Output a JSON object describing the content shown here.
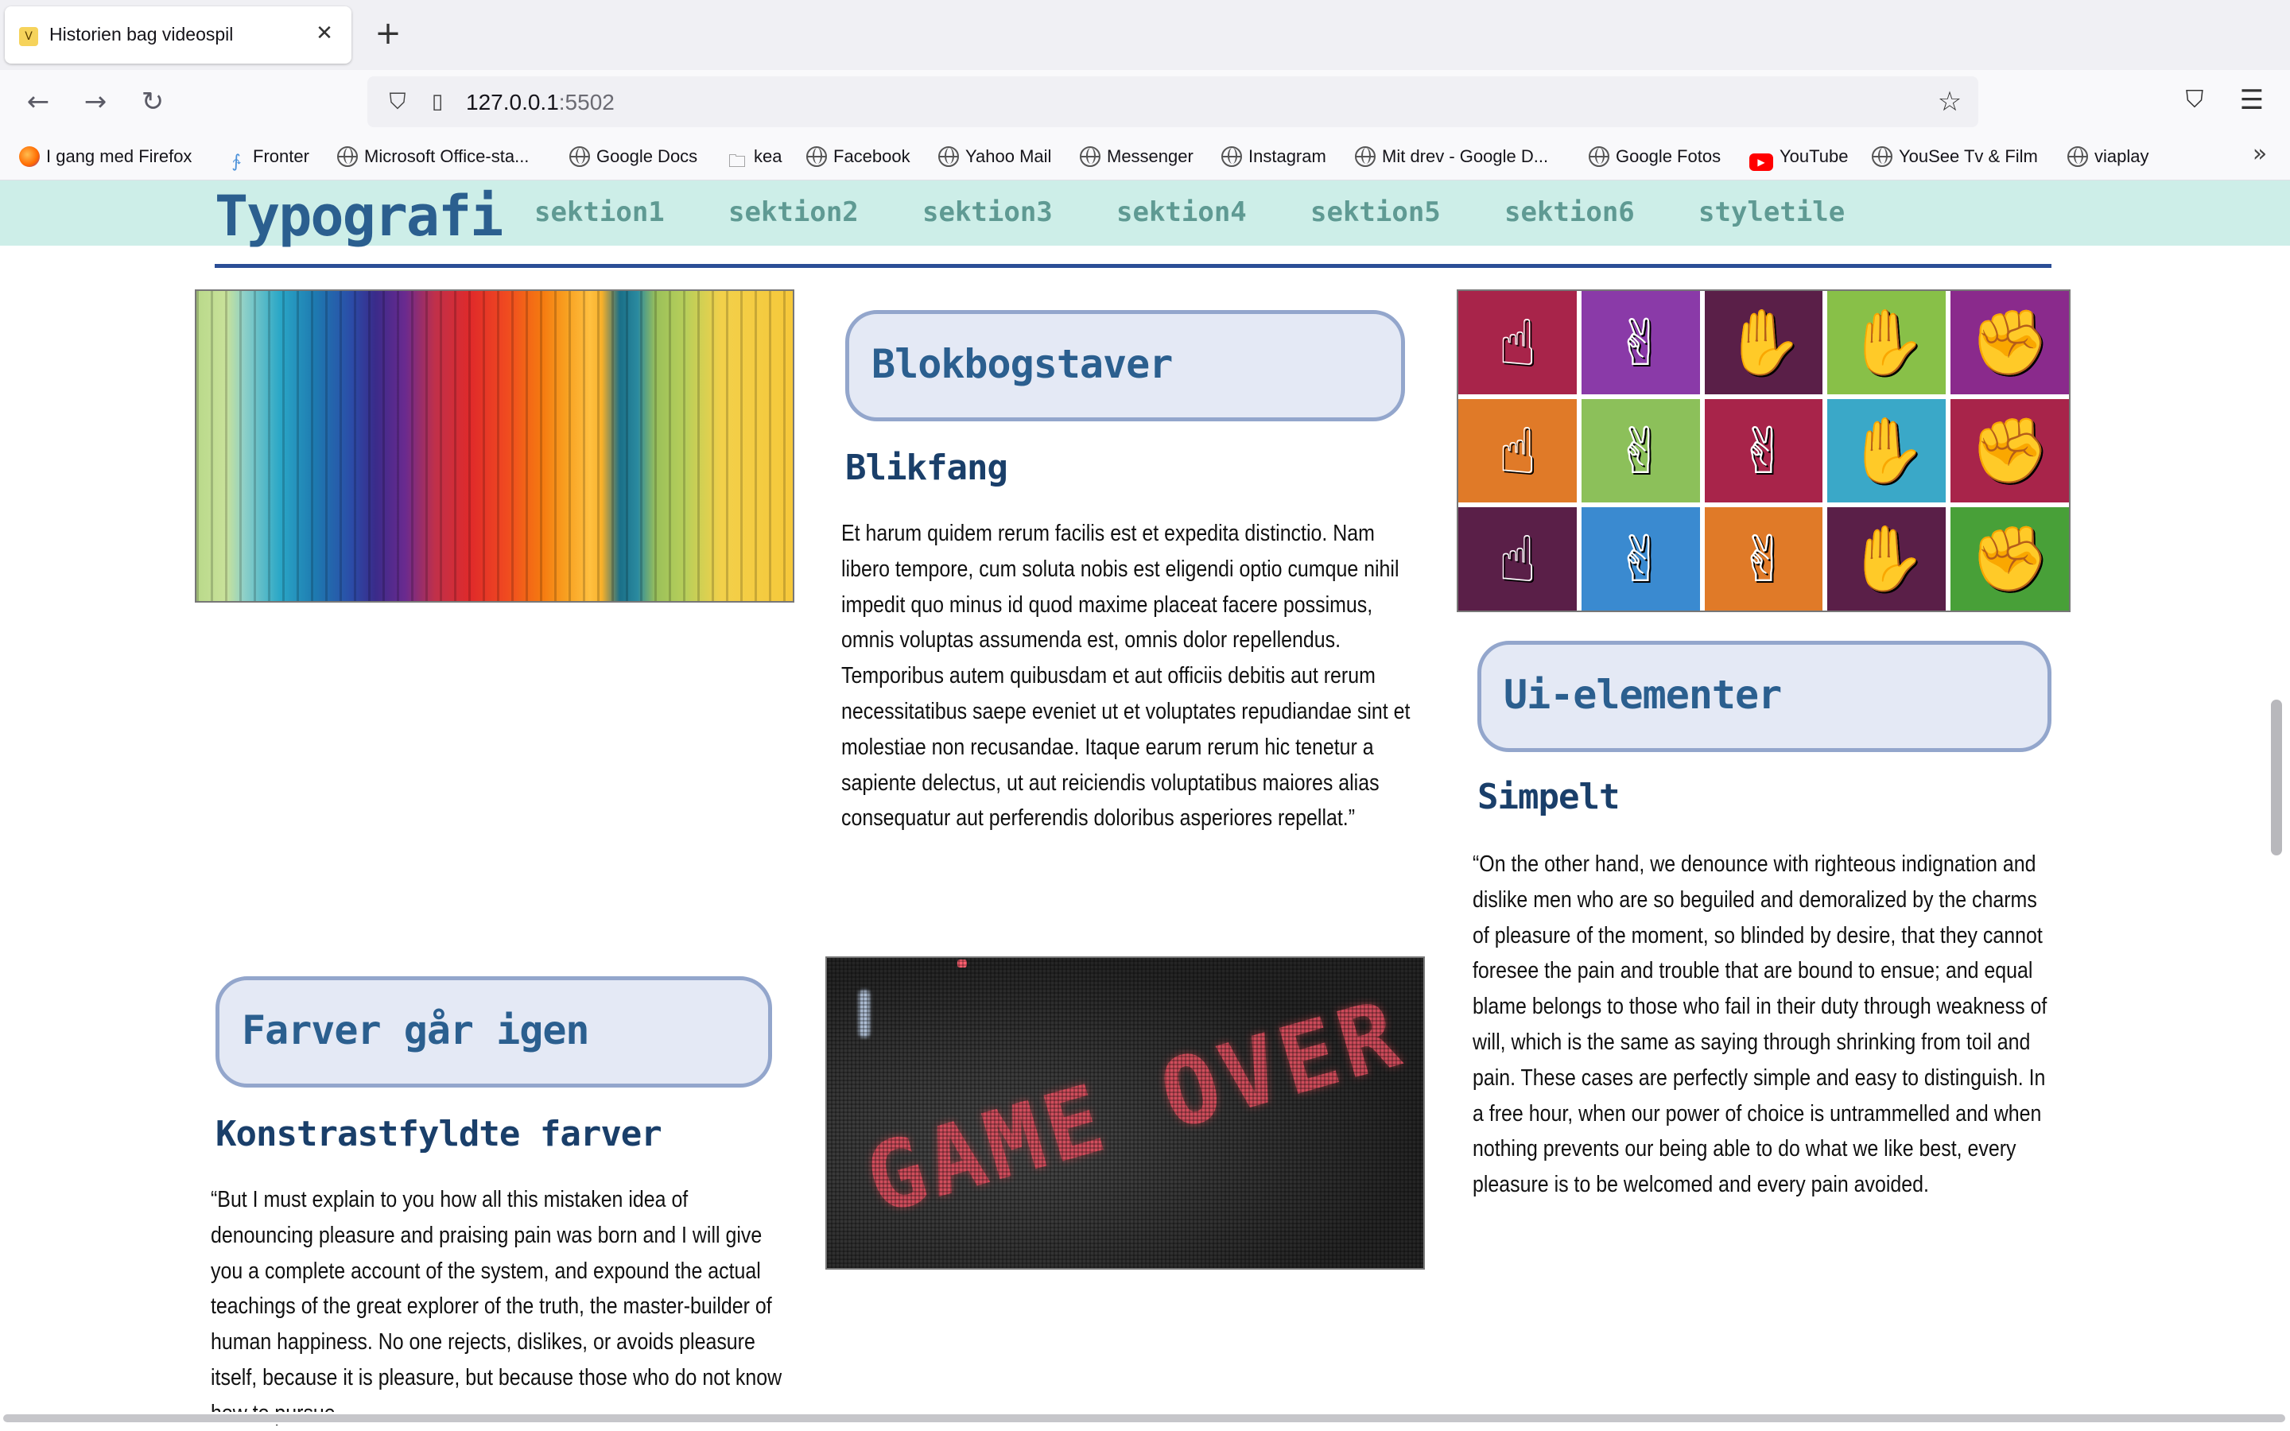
{
  "browser": {
    "tab_title": "Historien bag videospil",
    "tab_favicon": "V",
    "url_host": "127.0.0.1",
    "url_port": ":5502",
    "bookmarks": [
      {
        "label": "I gang med Firefox",
        "icon": "firefox-icon"
      },
      {
        "label": "Fronter",
        "icon": "fronter-icon"
      },
      {
        "label": "Microsoft Office-sta...",
        "icon": "globe-icon"
      },
      {
        "label": "Google Docs",
        "icon": "globe-icon"
      },
      {
        "label": "kea",
        "icon": "folder-icon"
      },
      {
        "label": "Facebook",
        "icon": "globe-icon"
      },
      {
        "label": "Yahoo Mail",
        "icon": "globe-icon"
      },
      {
        "label": "Messenger",
        "icon": "globe-icon"
      },
      {
        "label": "Instagram",
        "icon": "globe-icon"
      },
      {
        "label": "Mit drev - Google D...",
        "icon": "globe-icon"
      },
      {
        "label": "Google Fotos",
        "icon": "globe-icon"
      },
      {
        "label": "YouTube",
        "icon": "youtube-icon"
      },
      {
        "label": "YouSee Tv & Film",
        "icon": "globe-icon"
      },
      {
        "label": "viaplay",
        "icon": "globe-icon"
      }
    ]
  },
  "site": {
    "logo": "Typografi",
    "nav": [
      "sektion1",
      "sektion2",
      "sektion3",
      "sektion4",
      "sektion5",
      "sektion6",
      "styletile"
    ]
  },
  "sections": {
    "blok": {
      "heading": "Blokbogstaver",
      "subheading": "Blikfang",
      "body": "Et harum quidem rerum facilis est et expedita distinctio. Nam libero tempore, cum soluta nobis est eligendi optio cumque nihil impedit quo minus id quod maxime placeat facere possimus, omnis voluptas assumenda est, omnis dolor repellendus. Temporibus autem quibusdam et aut officiis debitis aut rerum necessitatibus saepe eveniet ut et voluptates repudiandae sint et molestiae non recusandae. Itaque earum rerum hic tenetur a sapiente delectus, ut aut reiciendis voluptatibus maiores alias consequatur aut perferendis doloribus asperiores repellat.”"
    },
    "ui": {
      "heading": "Ui-elementer",
      "subheading": "Simpelt",
      "body": "“On the other hand, we denounce with righteous indignation and dislike men who are so beguiled and demoralized by the charms of pleasure of the moment, so blinded by desire, that they cannot foresee the pain and trouble that are bound to ensue; and equal blame belongs to those who fail in their duty through weakness of will, which is the same as saying through shrinking from toil and pain. These cases are perfectly simple and easy to distinguish. In a free hour, when our power of choice is untrammelled and when nothing prevents our being able to do what we like best, every pleasure is to be welcomed and every pain avoided."
    },
    "farver": {
      "heading": "Farver går igen",
      "subheading": "Konstrastfyldte farver",
      "body": "“But I must explain to you how all this mistaken idea of denouncing pleasure and praising pain was born and I will give you a complete account of the system, and expound the actual teachings of the great explorer of the truth, the master-builder of human happiness. No one rejects, dislikes, or avoids pleasure itself, because it is pleasure, but because those who do not know how to pursue"
    },
    "gameover_image_text": "GAME OVER"
  },
  "hand_grid": {
    "colors": [
      "#a8244a",
      "#8a3aa8",
      "#5a1f48",
      "#88c048",
      "#8a2a8c",
      "#e07a28",
      "#8cc05a",
      "#a8244a",
      "#3aa8c8",
      "#a8244a",
      "#5a1f48",
      "#3a8ad0",
      "#e07a28",
      "#5a1f48",
      "#48a038"
    ],
    "icons": [
      "hand-point-icon",
      "hand-peace-icon",
      "hand-open-icon",
      "hand-open-icon",
      "fist-icon",
      "hand-point-icon",
      "hand-peace-icon",
      "hand-three-icon",
      "hand-four-icon",
      "fist-icon",
      "hand-point-icon",
      "hand-peace-icon",
      "hand-rock-icon",
      "hand-open-icon",
      "thumbs-down-icon"
    ]
  }
}
